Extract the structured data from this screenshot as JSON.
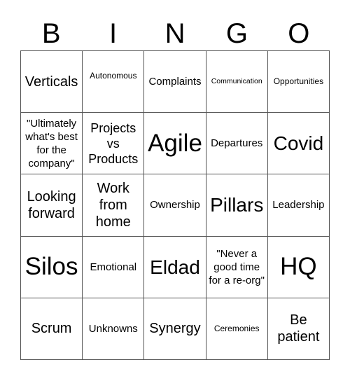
{
  "header": {
    "letters": [
      "B",
      "I",
      "N",
      "G",
      "O"
    ]
  },
  "grid": {
    "rows": [
      [
        "Verticals",
        "Autonomous",
        "Complaints",
        "Communication",
        "Opportunities"
      ],
      [
        "\"Ultimately what's best for the company\"",
        "Projects vs Products",
        "Agile",
        "Departures",
        "Covid"
      ],
      [
        "Looking forward",
        "Work from home",
        "Ownership",
        "Pillars",
        "Leadership"
      ],
      [
        "Silos",
        "Emotional",
        "Eldad",
        "\"Never a good time for a re-org\"",
        "HQ"
      ],
      [
        "Scrum",
        "Unknowns",
        "Synergy",
        "Ceremonies",
        "Be patient"
      ]
    ]
  }
}
